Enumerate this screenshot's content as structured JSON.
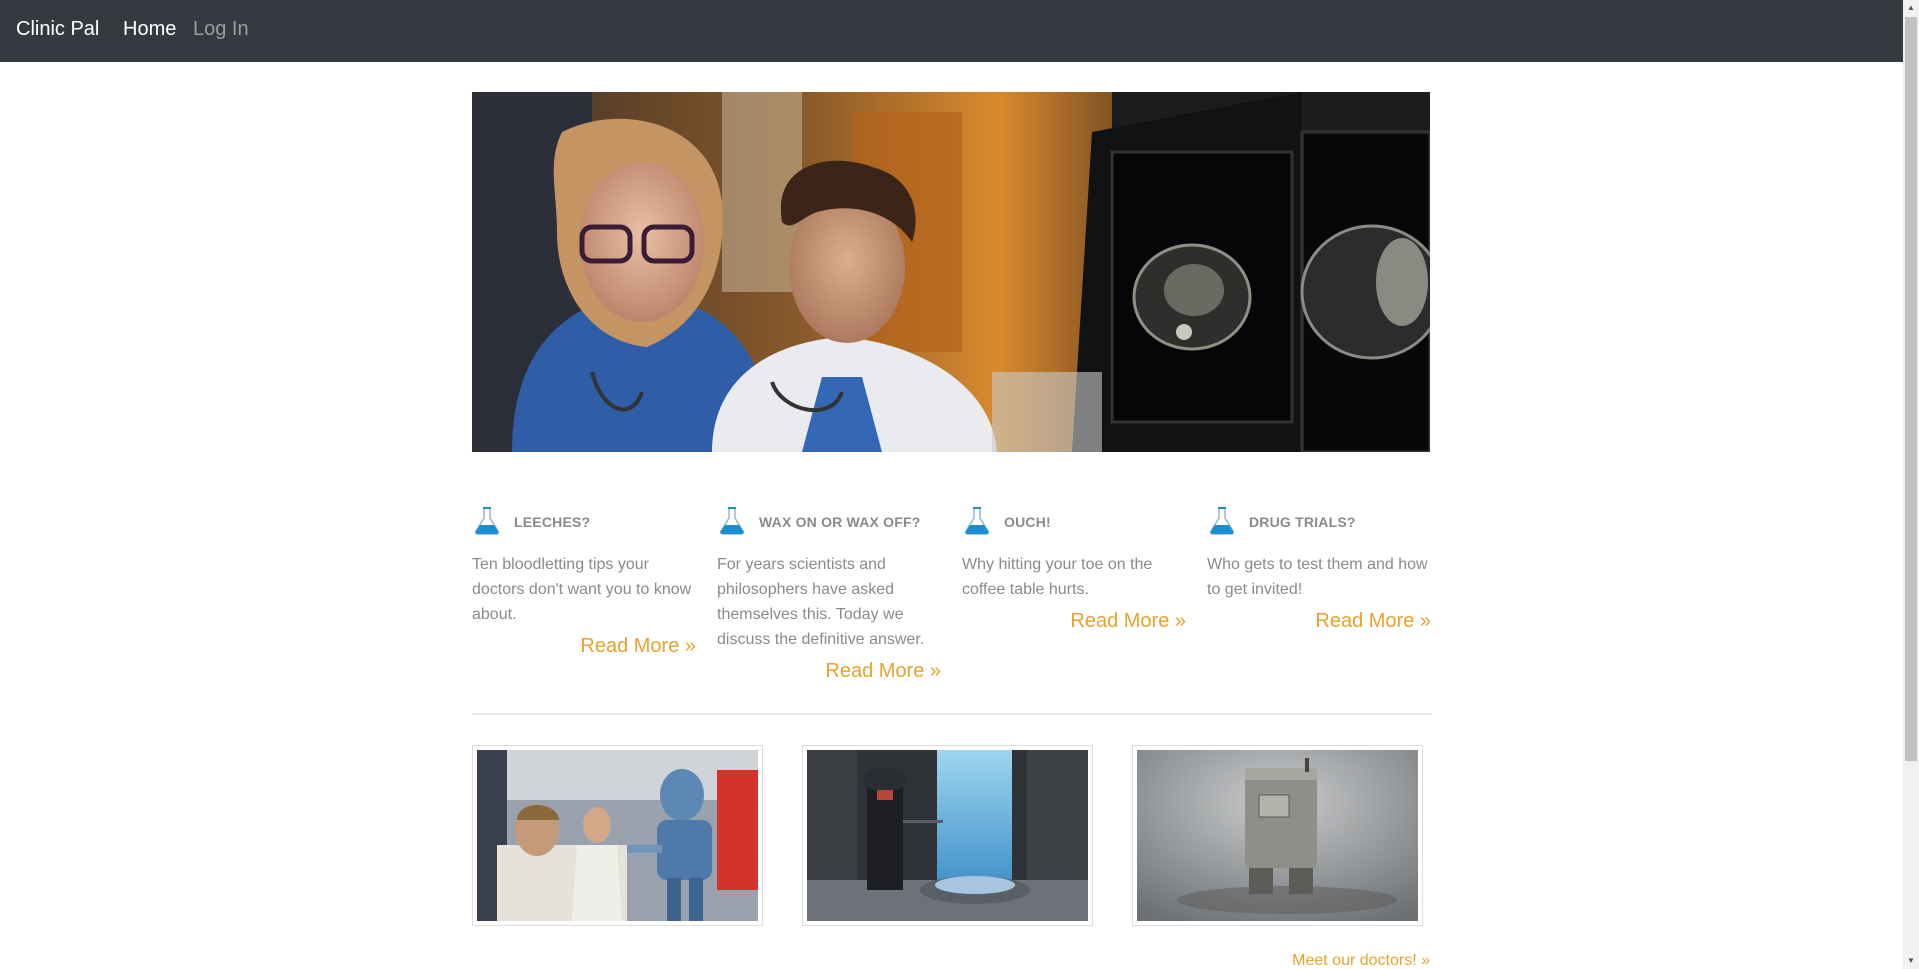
{
  "nav": {
    "brand": "Clinic Pal",
    "home": "Home",
    "login": "Log In"
  },
  "hero": {
    "image": "doctors-reviewing-ct-scans"
  },
  "features": [
    {
      "icon": "flask-icon",
      "title": "LEECHES?",
      "text": "Ten bloodletting tips your doctors don't want you to know about.",
      "link": "Read More »"
    },
    {
      "icon": "flask-icon",
      "title": "WAX ON OR WAX OFF?",
      "text": "For years scientists and philosophers have asked themselves this. Today we discuss the definitive answer.",
      "link": "Read More »"
    },
    {
      "icon": "flask-icon",
      "title": "OUCH!",
      "text": "Why hitting your toe on the coffee table hurts.",
      "link": "Read More »"
    },
    {
      "icon": "flask-icon",
      "title": "DRUG TRIALS?",
      "text": "Who gets to test them and how to get invited!",
      "link": "Read More »"
    }
  ],
  "doctors": {
    "images": [
      "medical-droid-with-patient",
      "medical-droid-bacta-tank",
      "gonk-droid"
    ],
    "link": "Meet our doctors! »"
  },
  "colors": {
    "navbar": "#343a40",
    "accent": "#e8a22c",
    "flask": "#1a8ed1"
  }
}
